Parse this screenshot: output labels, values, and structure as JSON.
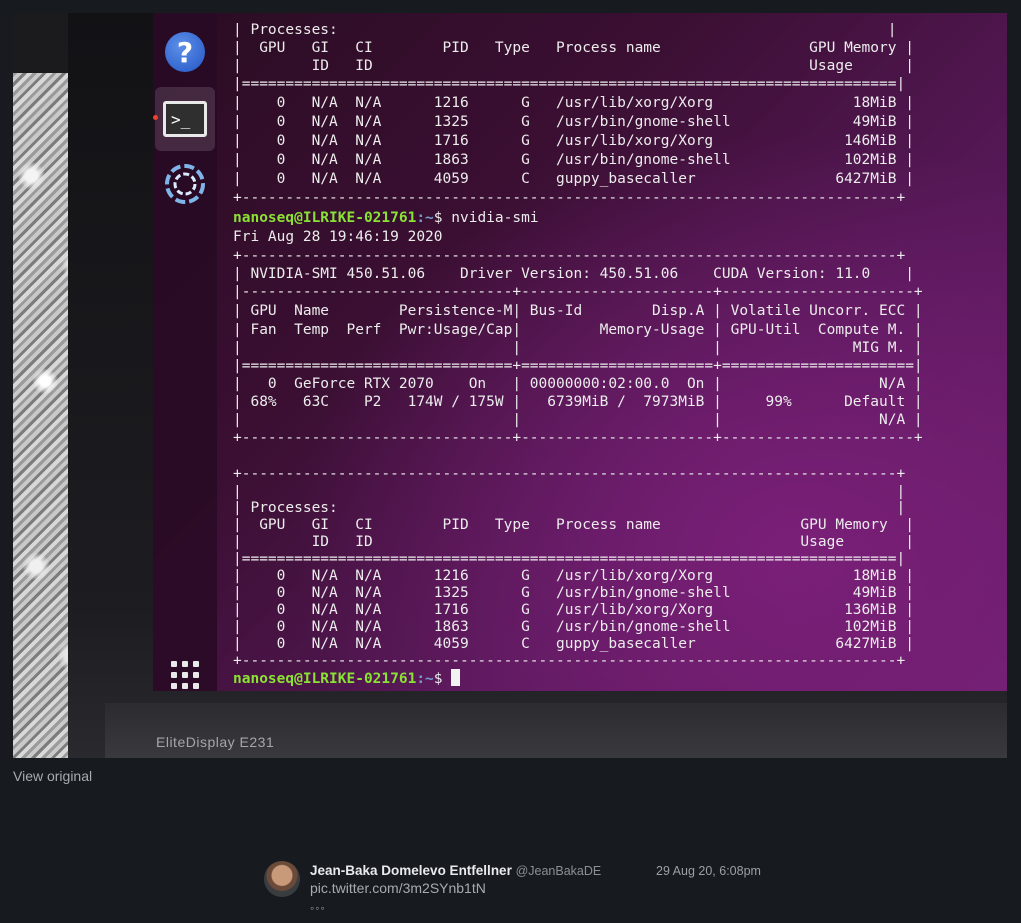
{
  "photo": {
    "monitor_brand": "EliteDisplay E231",
    "dock": {
      "icons": [
        "help-icon",
        "terminal-icon",
        "guppy-icon",
        "show-applications-icon"
      ],
      "help_glyph": "?",
      "terminal_glyph": ">_"
    },
    "terminal": {
      "lines": [
        "| Processes:                                                               |",
        "|  GPU   GI   CI        PID   Type   Process name                 GPU Memory |",
        "|        ID   ID                                                  Usage      |",
        "|===========================================================================|",
        "|    0   N/A  N/A      1216      G   /usr/lib/xorg/Xorg                18MiB |",
        "|    0   N/A  N/A      1325      G   /usr/bin/gnome-shell              49MiB |",
        "|    0   N/A  N/A      1716      G   /usr/lib/xorg/Xorg               146MiB |",
        "|    0   N/A  N/A      1863      G   /usr/bin/gnome-shell             102MiB |",
        "|    0   N/A  N/A      4059      C   guppy_basecaller                6427MiB |",
        "+---------------------------------------------------------------------------+",
        "",
        "Fri Aug 28 19:46:19 2020",
        "+---------------------------------------------------------------------------+",
        "| NVIDIA-SMI 450.51.06    Driver Version: 450.51.06    CUDA Version: 11.0    |",
        "|-------------------------------+----------------------+----------------------+",
        "| GPU  Name        Persistence-M| Bus-Id        Disp.A | Volatile Uncorr. ECC |",
        "| Fan  Temp  Perf  Pwr:Usage/Cap|         Memory-Usage | GPU-Util  Compute M. |",
        "|                               |                      |               MIG M. |",
        "|===============================+======================+======================|",
        "|   0  GeForce RTX 2070    On   | 00000000:02:00.0  On |                  N/A |",
        "| 68%   63C    P2   174W / 175W |   6739MiB /  7973MiB |     99%      Default |",
        "|                               |                      |                  N/A |",
        "+-------------------------------+----------------------+----------------------+",
        "",
        "+---------------------------------------------------------------------------+",
        "|                                                                           |",
        "| Processes:                                                                |",
        "|  GPU   GI   CI        PID   Type   Process name                GPU Memory  |",
        "|        ID   ID                                                 Usage       |",
        "|===========================================================================|",
        "|    0   N/A  N/A      1216      G   /usr/lib/xorg/Xorg                18MiB |",
        "|    0   N/A  N/A      1325      G   /usr/bin/gnome-shell              49MiB |",
        "|    0   N/A  N/A      1716      G   /usr/lib/xorg/Xorg               136MiB |",
        "|    0   N/A  N/A      1863      G   /usr/bin/gnome-shell             102MiB |",
        "|    0   N/A  N/A      4059      C   guppy_basecaller                6427MiB |",
        "+---------------------------------------------------------------------------+"
      ],
      "prompt1": {
        "user": "nanoseq@ILRIKE-021761",
        "path": ":~",
        "symbol": "$ ",
        "command": "nvidia-smi"
      },
      "prompt2": {
        "user": "nanoseq@ILRIKE-021761",
        "path": ":~",
        "symbol": "$ ",
        "command": ""
      }
    }
  },
  "view_original": "View original",
  "tweet": {
    "author": "Jean-Baka Domelevo Entfellner",
    "handle": "@JeanBakaDE",
    "date": "29 Aug 20, 6:08pm",
    "link": "pic.twitter.com/3m2SYnb1tN",
    "more": "◦◦◦"
  },
  "colors": {
    "page_bg": "#171b1f",
    "terminal_bg": "#3b0f33",
    "prompt_user": "#8ae234",
    "prompt_path": "#729fcf"
  }
}
